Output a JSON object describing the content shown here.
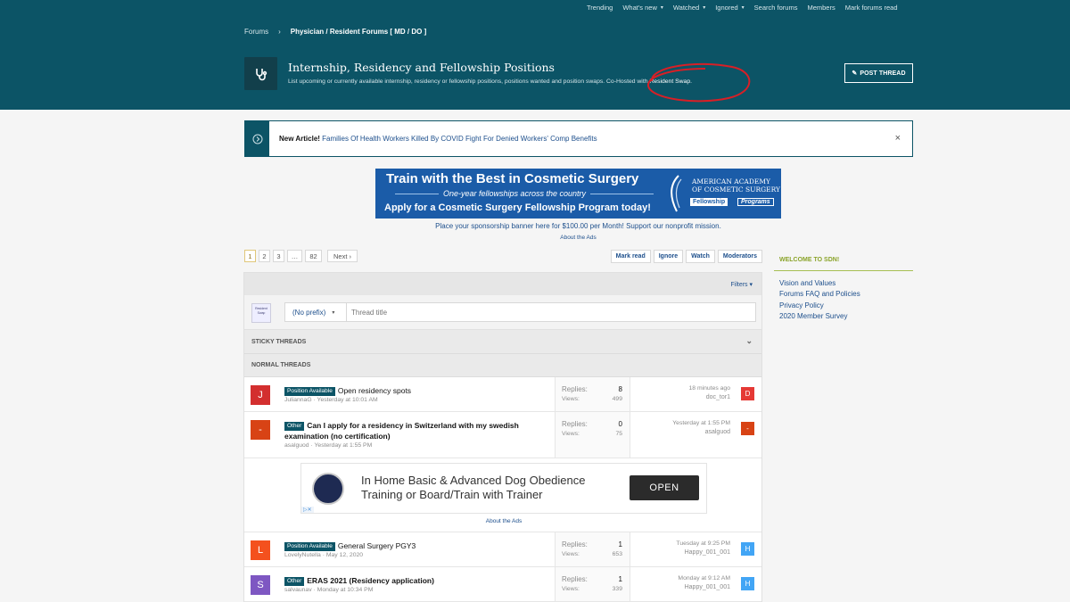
{
  "topnav": {
    "items": [
      {
        "label": "Trending",
        "caret": false
      },
      {
        "label": "What's new",
        "caret": true
      },
      {
        "label": "Watched",
        "caret": true
      },
      {
        "label": "Ignored",
        "caret": true
      },
      {
        "label": "Search forums",
        "caret": false
      },
      {
        "label": "Members",
        "caret": false
      },
      {
        "label": "Mark forums read",
        "caret": false
      }
    ]
  },
  "breadcrumb": {
    "root": "Forums",
    "current": "Physician / Resident Forums [ MD / DO ]"
  },
  "forum": {
    "title": "Internship, Residency and Fellowship Positions",
    "description_prefix": "List upcoming or currently available internship, residency or fellowship positions, positions wanted and position swaps. Co-Hosted with ",
    "description_link": "Resident Swap",
    "description_suffix": ".",
    "post_thread_label": "POST THREAD",
    "icon": "stethoscope-icon"
  },
  "notice": {
    "bold": "New Article!",
    "link": "Families Of Health Workers Killed By COVID Fight For Denied Workers' Comp Benefits"
  },
  "banner_ad": {
    "line1": "Train with the Best in Cosmetic Surgery",
    "line2": "One-year fellowships across the country",
    "line3": "Apply for a Cosmetic Surgery Fellowship Program today!",
    "org_line1": "AMERICAN ACADEMY",
    "org_line2": "OF COSMETIC SURGERY",
    "fellowship": "Fellowship",
    "programs": "Programs"
  },
  "sponsor_text": "Place your sponsorship banner here for $100.00 per Month! Support our nonprofit mission.",
  "about_ads": "About the Ads",
  "pagination": {
    "pages": [
      "1",
      "2",
      "3",
      "…",
      "82"
    ],
    "next": "Next ›"
  },
  "actions": [
    "Mark read",
    "Ignore",
    "Watch",
    "Moderators"
  ],
  "filters_label": "Filters ▾",
  "quick_thread": {
    "logo_text": "Resident Swap",
    "prefix": "(No prefix)",
    "placeholder": "Thread title"
  },
  "sections": {
    "sticky": "STICKY THREADS",
    "normal": "NORMAL THREADS"
  },
  "threads": [
    {
      "label": "Position Available",
      "title": "Open residency spots",
      "bold": false,
      "author": "JuliannaG",
      "date": "Yesterday at 10:01 AM",
      "replies": "8",
      "views": "499",
      "last_when": "18 minutes ago",
      "last_who": "doc_tor1",
      "avatar_letter": "J",
      "avatar_color": "#d32f2f",
      "last_avatar_letter": "D",
      "last_avatar_color": "#e53935"
    },
    {
      "label": "Other",
      "title": "Can I apply for a residency in Switzerland with my swedish examination (no certification)",
      "bold": true,
      "author": "asalguod",
      "date": "Yesterday at 1:55 PM",
      "replies": "0",
      "views": "75",
      "last_when": "Yesterday at 1:55 PM",
      "last_who": "asalguod",
      "avatar_letter": "-",
      "avatar_color": "#d84315",
      "last_avatar_letter": "-",
      "last_avatar_color": "#d84315"
    },
    {
      "label": "Position Available",
      "title": "General Surgery PGY3",
      "bold": false,
      "author": "LovelyNutella",
      "date": "May 12, 2020",
      "replies": "1",
      "views": "653",
      "last_when": "Tuesday at 9:25 PM",
      "last_who": "Happy_001_001",
      "avatar_letter": "L",
      "avatar_color": "#f4511e",
      "last_avatar_letter": "H",
      "last_avatar_color": "#42a5f5"
    },
    {
      "label": "Other",
      "title": "ERAS 2021 (Residency application)",
      "bold": true,
      "author": "salvaunav",
      "date": "Monday at 10:34 PM",
      "replies": "1",
      "views": "339",
      "last_when": "Monday at 9:12 AM",
      "last_who": "Happy_001_001",
      "avatar_letter": "S",
      "avatar_color": "#7e57c2",
      "last_avatar_letter": "H",
      "last_avatar_color": "#42a5f5"
    }
  ],
  "stat_labels": {
    "replies": "Replies:",
    "views": "Views:"
  },
  "inline_ad": {
    "text_line1": "In Home Basic & Advanced Dog Obedience",
    "text_line2": "Training or Board/Train with Trainer",
    "button": "OPEN"
  },
  "sidebar": {
    "head": "WELCOME TO SDN!",
    "links": [
      "Vision and Values",
      "Forums FAQ and Policies",
      "Privacy Policy",
      "2020 Member Survey"
    ]
  }
}
